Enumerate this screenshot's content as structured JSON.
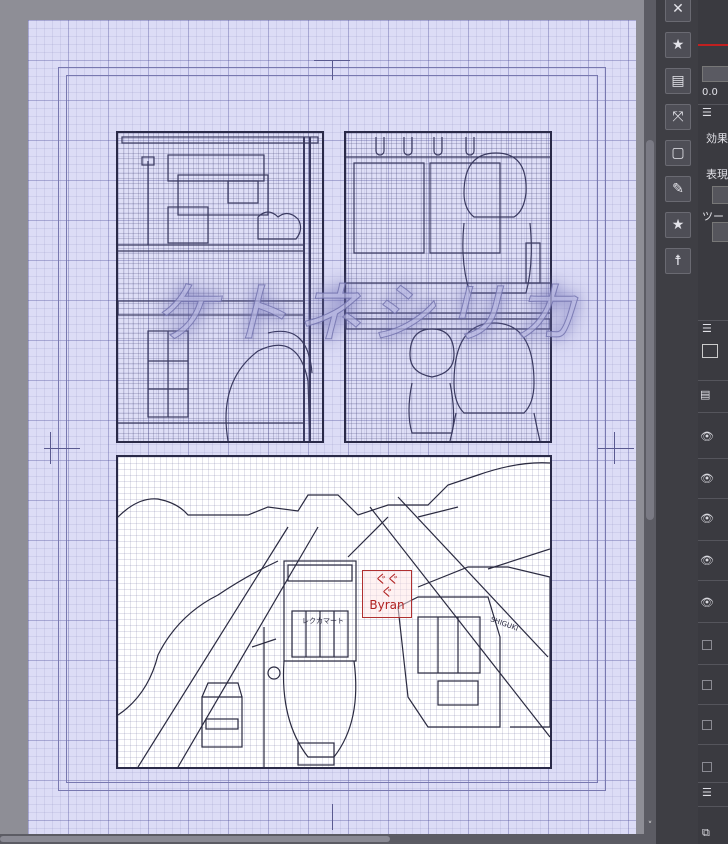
{
  "artwork": {
    "title_overlay": "ケトネシリカ",
    "seal_lines": [
      "ぐぐ",
      "ぐ",
      "Byran"
    ],
    "tram_sign": "レクカマート",
    "bus_sign": "SHIGUKI"
  },
  "right_panel": {
    "value_field": "0.0",
    "effect_label": "効果",
    "expression_label": "表現",
    "tool_label": "ツー"
  },
  "tool_icons": [
    "close-icon",
    "star-folder-icon",
    "layers-icon",
    "transform-icon",
    "page-icon",
    "edit-icon",
    "star-folder-icon",
    "figure-icon"
  ],
  "layer_rows": 10,
  "colors": {
    "page": "#dcdcf6",
    "panel_bg": "#3a3a40",
    "accent_red": "#c02020"
  }
}
